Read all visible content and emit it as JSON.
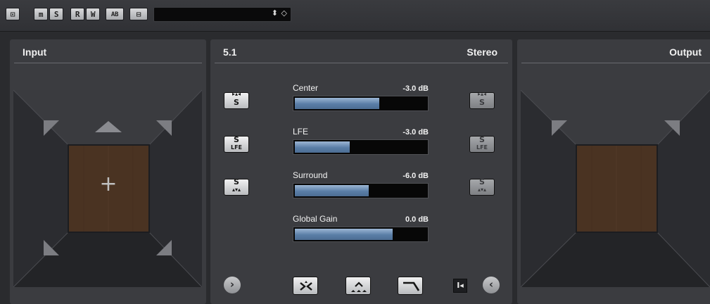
{
  "toolbar": {
    "buttons": [
      {
        "name": "single-view-button",
        "glyph": "⊡"
      },
      {
        "name": "mute-button",
        "glyph": "m"
      },
      {
        "name": "solo-button",
        "glyph": "S"
      },
      {
        "name": "read-automation-button",
        "glyph": "R"
      },
      {
        "name": "write-automation-button",
        "glyph": "W"
      },
      {
        "name": "ab-compare-button",
        "glyph": "AB"
      },
      {
        "name": "bypass-button",
        "glyph": "⊟"
      }
    ],
    "preset_value": "",
    "preset_arrows": "⬍",
    "preset_menu_icon": "◇"
  },
  "input_panel": {
    "title": "Input",
    "cursor_icon": "+"
  },
  "center_panel": {
    "format_left": "5.1",
    "format_right": "Stereo",
    "params": [
      {
        "label": "Center",
        "value": "-3.0 dB",
        "level": 0.65
      },
      {
        "label": "LFE",
        "value": "-3.0 dB",
        "level": 0.42
      },
      {
        "label": "Surround",
        "value": "-6.0 dB",
        "level": 0.57
      },
      {
        "label": "Global Gain",
        "value": "0.0 dB",
        "level": 0.75
      }
    ],
    "left_buttons": [
      {
        "name": "center-solo-left-button",
        "top": "S",
        "sub": "▸▴◂"
      },
      {
        "name": "lfe-solo-left-button",
        "top": "S",
        "sub": "LFE"
      },
      {
        "name": "surround-solo-left-button",
        "top": "S",
        "sub": "▴▾▴"
      }
    ],
    "right_buttons": [
      {
        "name": "center-solo-right-button",
        "top": "S",
        "sub": "▸▴◂"
      },
      {
        "name": "lfe-solo-right-button",
        "top": "S",
        "sub": "LFE"
      },
      {
        "name": "surround-solo-right-button",
        "top": "S",
        "sub": "▴▾▴"
      }
    ],
    "expand_left_icon": "›",
    "expand_right_icon": "‹",
    "small_button_glyph": "I◂"
  },
  "output_panel": {
    "title": "Output"
  },
  "colors": {
    "meter_fill": "#5a7ea7",
    "panel_bg": "#3b3c40",
    "stage_floor": "#4a3322"
  }
}
